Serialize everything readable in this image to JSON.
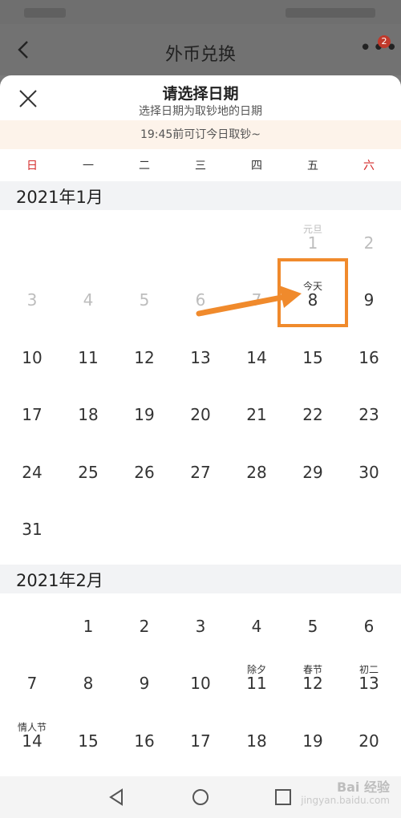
{
  "app": {
    "title": "外币兑换",
    "badge_count": "2"
  },
  "sheet": {
    "title": "请选择日期",
    "subtitle": "选择日期为取钞地的日期",
    "notice": "19:45前可订今日取钞~"
  },
  "weekdays": [
    "日",
    "一",
    "二",
    "三",
    "四",
    "五",
    "六"
  ],
  "months": [
    {
      "label": "2021年1月",
      "rows": [
        [
          null,
          null,
          null,
          null,
          null,
          {
            "n": "1",
            "tag": "元旦",
            "disabled": true
          },
          {
            "n": "2",
            "disabled": true
          }
        ],
        [
          {
            "n": "3",
            "disabled": true
          },
          {
            "n": "4",
            "disabled": true
          },
          {
            "n": "5",
            "disabled": true
          },
          {
            "n": "6",
            "disabled": true
          },
          {
            "n": "7",
            "disabled": true
          },
          {
            "n": "8",
            "tag": "今天"
          },
          {
            "n": "9"
          }
        ],
        [
          {
            "n": "10"
          },
          {
            "n": "11"
          },
          {
            "n": "12"
          },
          {
            "n": "13"
          },
          {
            "n": "14"
          },
          {
            "n": "15"
          },
          {
            "n": "16"
          }
        ],
        [
          {
            "n": "17"
          },
          {
            "n": "18"
          },
          {
            "n": "19"
          },
          {
            "n": "20"
          },
          {
            "n": "21"
          },
          {
            "n": "22"
          },
          {
            "n": "23"
          }
        ],
        [
          {
            "n": "24"
          },
          {
            "n": "25"
          },
          {
            "n": "26"
          },
          {
            "n": "27"
          },
          {
            "n": "28"
          },
          {
            "n": "29"
          },
          {
            "n": "30"
          }
        ],
        [
          {
            "n": "31"
          },
          null,
          null,
          null,
          null,
          null,
          null
        ]
      ]
    },
    {
      "label": "2021年2月",
      "rows": [
        [
          null,
          {
            "n": "1"
          },
          {
            "n": "2"
          },
          {
            "n": "3"
          },
          {
            "n": "4"
          },
          {
            "n": "5"
          },
          {
            "n": "6"
          }
        ],
        [
          {
            "n": "7"
          },
          {
            "n": "8"
          },
          {
            "n": "9"
          },
          {
            "n": "10"
          },
          {
            "n": "11",
            "tag": "除夕"
          },
          {
            "n": "12",
            "tag": "春节"
          },
          {
            "n": "13",
            "tag": "初二"
          }
        ],
        [
          {
            "n": "14",
            "tag": "情人节"
          },
          {
            "n": "15"
          },
          {
            "n": "16"
          },
          {
            "n": "17"
          },
          {
            "n": "18"
          },
          {
            "n": "19"
          },
          {
            "n": "20"
          }
        ]
      ]
    }
  ],
  "watermark": {
    "brand": "Bai 经验",
    "url": "jingyan.baidu.com"
  },
  "colors": {
    "sunday_saturday": "#d42a2a",
    "highlight": "#f08a2c",
    "notice_bg": "#fdf3ea"
  }
}
